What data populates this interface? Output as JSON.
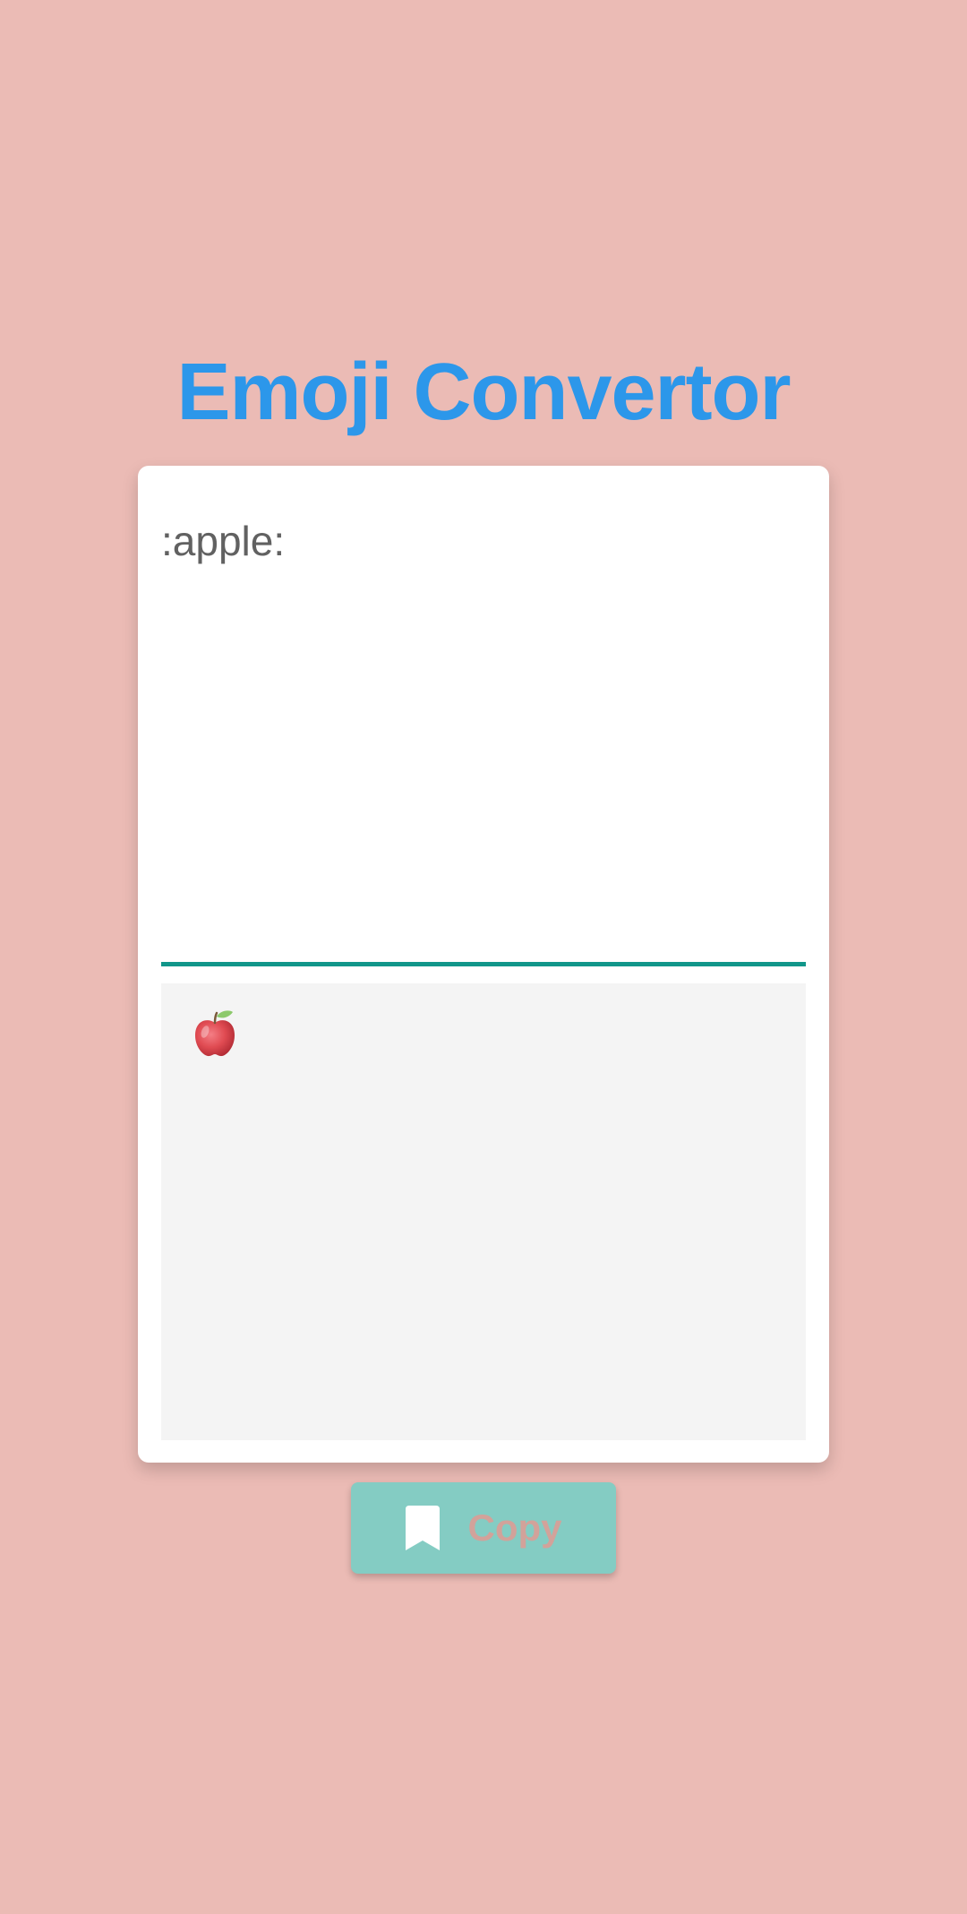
{
  "app": {
    "title": "Emoji Convertor"
  },
  "input": {
    "value": ":apple:"
  },
  "output": {
    "emoji_icon": "red-apple-emoji"
  },
  "copy_button": {
    "label": "Copy",
    "icon": "bookmark-icon"
  },
  "colors": {
    "background": "#EBBBB5",
    "title": "#2C97EA",
    "accent_underline": "#11968A",
    "button_background": "#84CCC3",
    "button_text": "#D2A29A",
    "output_background": "#F4F4F4"
  }
}
